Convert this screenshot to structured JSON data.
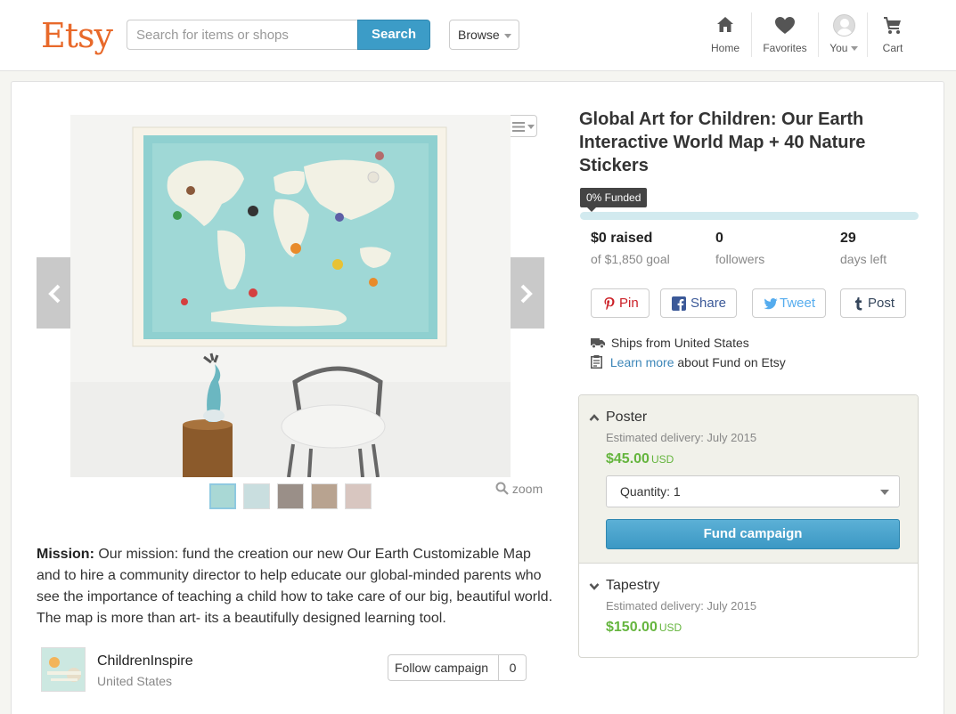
{
  "header": {
    "logo": "Etsy",
    "search_placeholder": "Search for items or shops",
    "search_button": "Search",
    "browse_label": "Browse",
    "nav": {
      "home": "Home",
      "favorites": "Favorites",
      "you": "You",
      "cart": "Cart"
    }
  },
  "gallery": {
    "zoom_label": "zoom",
    "thumbnail_count": 5
  },
  "campaign": {
    "title": "Global Art for Children: Our Earth Interactive World Map + 40 Nature Stickers",
    "funded_badge": "0% Funded",
    "funded_fraction": 0,
    "stats": [
      {
        "value": "$0 raised",
        "label": "of $1,850 goal"
      },
      {
        "value": "0",
        "label": "followers"
      },
      {
        "value": "29",
        "label": "days left"
      }
    ],
    "share": {
      "pin": "Pin",
      "share": "Share",
      "tweet": "Tweet",
      "post": "Post"
    },
    "ships_from": "Ships from United States",
    "learn_more_link": "Learn more",
    "learn_more_rest": " about Fund on Etsy"
  },
  "mission": {
    "label": "Mission:",
    "text": " Our mission: fund the creation our new Our Earth Customizable Map and to hire a community director to help educate our global-minded parents who see the importance of teaching a child how to take care of our big, beautiful world. The map is more than art- its a beautifully designed learning tool."
  },
  "shop": {
    "name": "ChildrenInspire",
    "location": "United States",
    "follow_label": "Follow campaign",
    "follow_count": "0"
  },
  "rewards": [
    {
      "name": "Poster",
      "delivery": "Estimated delivery: July 2015",
      "price": "$45.00",
      "currency": "USD",
      "quantity_label": "Quantity: 1",
      "fund_button": "Fund campaign",
      "expanded": true
    },
    {
      "name": "Tapestry",
      "delivery": "Estimated delivery: July 2015",
      "price": "$150.00",
      "currency": "USD",
      "expanded": false
    }
  ],
  "colors": {
    "brand": "#e8692a",
    "accent": "#3c9cc7",
    "price_green": "#65b53e",
    "progress_track": "#d2eaef",
    "pinterest_red": "#cb2027",
    "facebook_blue": "#3b5998",
    "twitter_blue": "#55acee",
    "tumblr_navy": "#35465c"
  }
}
